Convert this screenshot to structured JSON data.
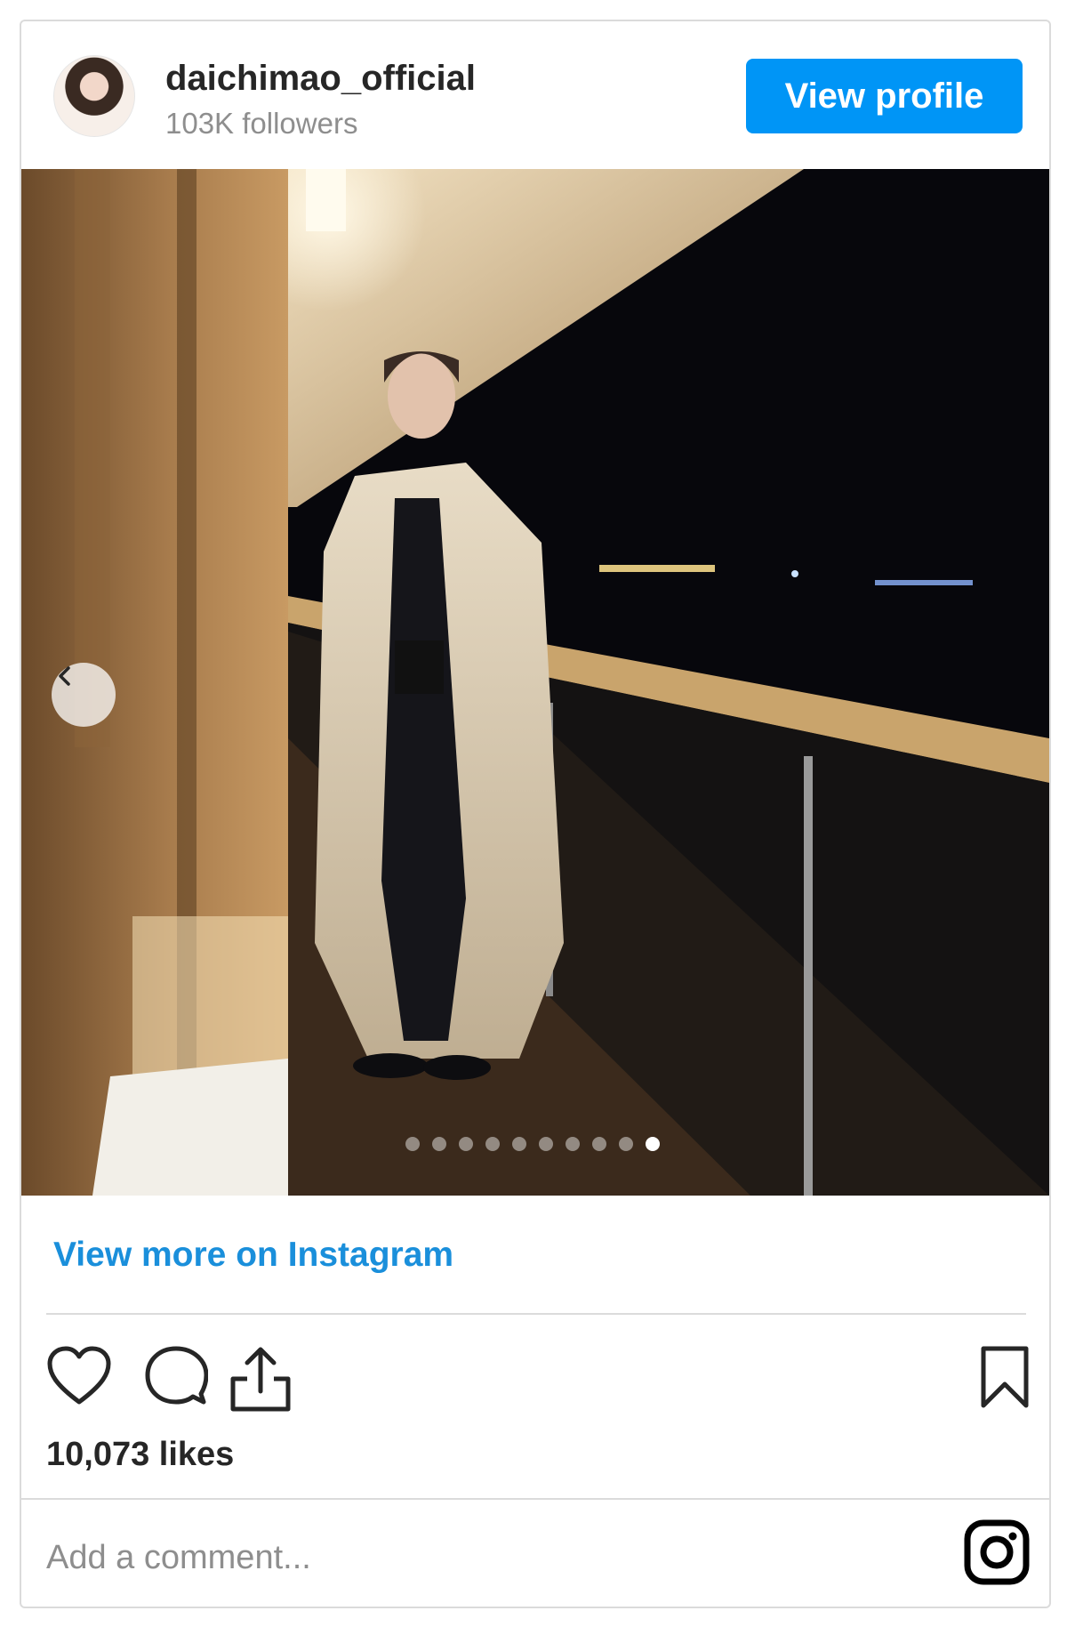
{
  "header": {
    "username": "daichimao_official",
    "followers": "103K followers",
    "view_profile_label": "View profile"
  },
  "carousel": {
    "slide_count": 10,
    "active_index": 9
  },
  "view_more_label": "View more on Instagram",
  "likes": "10,073 likes",
  "comment_placeholder": "Add a comment...",
  "icons": {
    "like": "heart-icon",
    "comment": "comment-icon",
    "share": "share-icon",
    "save": "bookmark-icon",
    "brand": "instagram-icon",
    "prev": "chevron-left-icon"
  },
  "colors": {
    "accent": "#0095f6",
    "link": "#1a8fdb",
    "muted": "#8e8e8e"
  }
}
